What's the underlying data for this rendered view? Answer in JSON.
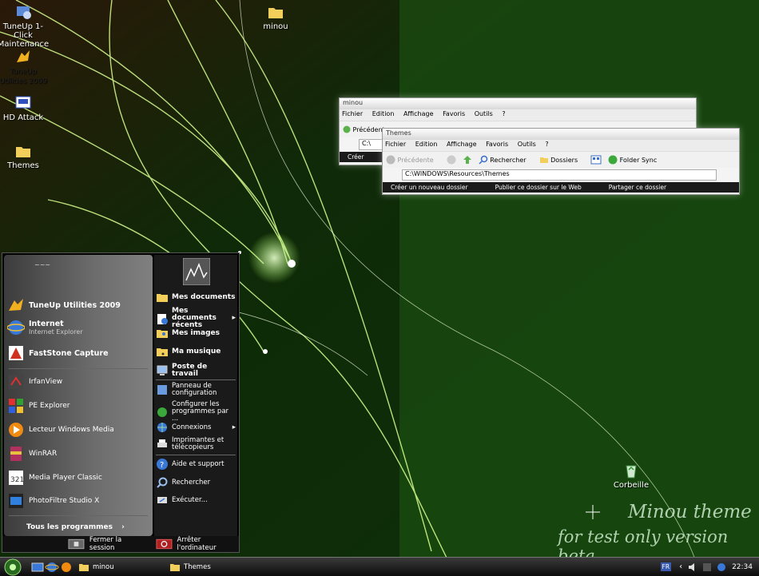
{
  "desktop": {
    "icons": [
      {
        "label": "TuneUp 1-Click Maintenance"
      },
      {
        "label": "TuneUp Utilities 2009"
      },
      {
        "label": "HD Attack"
      },
      {
        "label": "Themes"
      },
      {
        "label": "minou"
      },
      {
        "label": "Corbeille"
      }
    ],
    "watermark": {
      "line1": "Minou theme",
      "line2": "for test only version beta"
    }
  },
  "window_back": {
    "title": "minou",
    "menu": [
      "Fichier",
      "Edition",
      "Affichage",
      "Favoris",
      "Outils",
      "?"
    ],
    "back_label": "Précédente",
    "address": "C:\\",
    "task_label": "Créer"
  },
  "window_front": {
    "title": "Themes",
    "menu": [
      "Fichier",
      "Edition",
      "Affichage",
      "Favoris",
      "Outils",
      "?"
    ],
    "toolbar": {
      "back": "Précédente",
      "search": "Rechercher",
      "folders": "Dossiers",
      "folder_sync": "Folder Sync"
    },
    "address": "C:\\WINDOWS\\Resources\\Themes",
    "tasks": [
      "Créer un nouveau dossier",
      "Publier ce dossier sur le Web",
      "Partager ce dossier"
    ]
  },
  "start_menu": {
    "user": "~~~",
    "pinned": [
      {
        "label": "TuneUp Utilities 2009"
      },
      {
        "label": "Internet",
        "sub": "Internet Explorer"
      },
      {
        "label": "FastStone Capture"
      }
    ],
    "recent": [
      "IrfanView",
      "PE Explorer",
      "Lecteur Windows Media",
      "WinRAR",
      "Media Player Classic",
      "PhotoFiltre Studio X"
    ],
    "all_programs": "Tous les programmes",
    "right": {
      "mes_documents": "Mes documents",
      "recents_1": "Mes documents",
      "recents_2": "récents",
      "images": "Mes images",
      "musique": "Ma musique",
      "poste": "Poste de travail",
      "panneau_1": "Panneau de",
      "panneau_2": "configuration",
      "configurer_1": "Configurer les",
      "configurer_2": "programmes par ...",
      "connexions": "Connexions",
      "imprimantes_1": "Imprimantes et",
      "imprimantes_2": "télécopieurs",
      "aide": "Aide et support",
      "rechercher": "Rechercher",
      "executer": "Exécuter..."
    },
    "logoff": "Fermer la session",
    "shutdown": "Arrêter l'ordinateur"
  },
  "taskbar": {
    "tasks": [
      "minou",
      "Themes"
    ],
    "lang": "FR",
    "clock": "22:34"
  }
}
